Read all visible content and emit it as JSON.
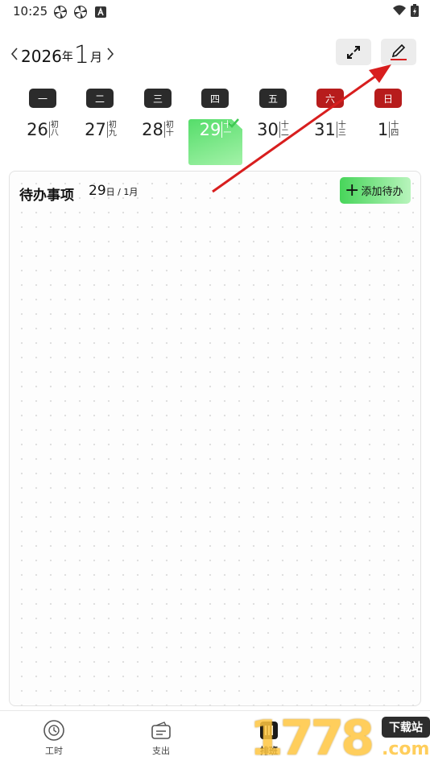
{
  "status_bar": {
    "time": "10:25",
    "icons": [
      "pinwheel-icon",
      "pinwheel-icon",
      "a-badge-icon"
    ],
    "right_icons": [
      "wifi-icon",
      "battery-icon"
    ]
  },
  "header": {
    "prev_icon": "chevron-left-icon",
    "year": "2026",
    "year_unit": "年",
    "month": "1",
    "month_unit": "月",
    "next_icon": "chevron-right-icon",
    "expand_icon": "expand-icon",
    "edit_icon": "pencil-icon"
  },
  "weekdays": [
    {
      "label": "一",
      "weekend": false
    },
    {
      "label": "二",
      "weekend": false
    },
    {
      "label": "三",
      "weekend": false
    },
    {
      "label": "四",
      "weekend": false
    },
    {
      "label": "五",
      "weekend": false
    },
    {
      "label": "六",
      "weekend": true
    },
    {
      "label": "日",
      "weekend": true
    }
  ],
  "dates": [
    {
      "day": "26",
      "lunar": "初八",
      "selected": false
    },
    {
      "day": "27",
      "lunar": "初九",
      "selected": false
    },
    {
      "day": "28",
      "lunar": "初十",
      "selected": false
    },
    {
      "day": "29",
      "lunar": "十一",
      "selected": true
    },
    {
      "day": "30",
      "lunar": "十二",
      "selected": false
    },
    {
      "day": "31",
      "lunar": "十三",
      "selected": false
    },
    {
      "day": "1",
      "lunar": "十四",
      "selected": false
    }
  ],
  "todo": {
    "title": "待办事项",
    "date_day": "29",
    "date_suffix": "日 / 1月",
    "add_label": "添加待办"
  },
  "nav": [
    {
      "label": "工时",
      "icon": "clock-icon"
    },
    {
      "label": "支出",
      "icon": "wallet-icon"
    },
    {
      "label": "排班",
      "icon": "schedule-icon"
    }
  ],
  "watermark": {
    "digits": "1778",
    "badge": "下载站",
    "suffix": ".com"
  },
  "colors": {
    "accent_green": "#47d55a",
    "weekend_red": "#b71c1c",
    "weekday_dark": "#2b2b2b",
    "annotation_arrow": "#d81e1e"
  }
}
